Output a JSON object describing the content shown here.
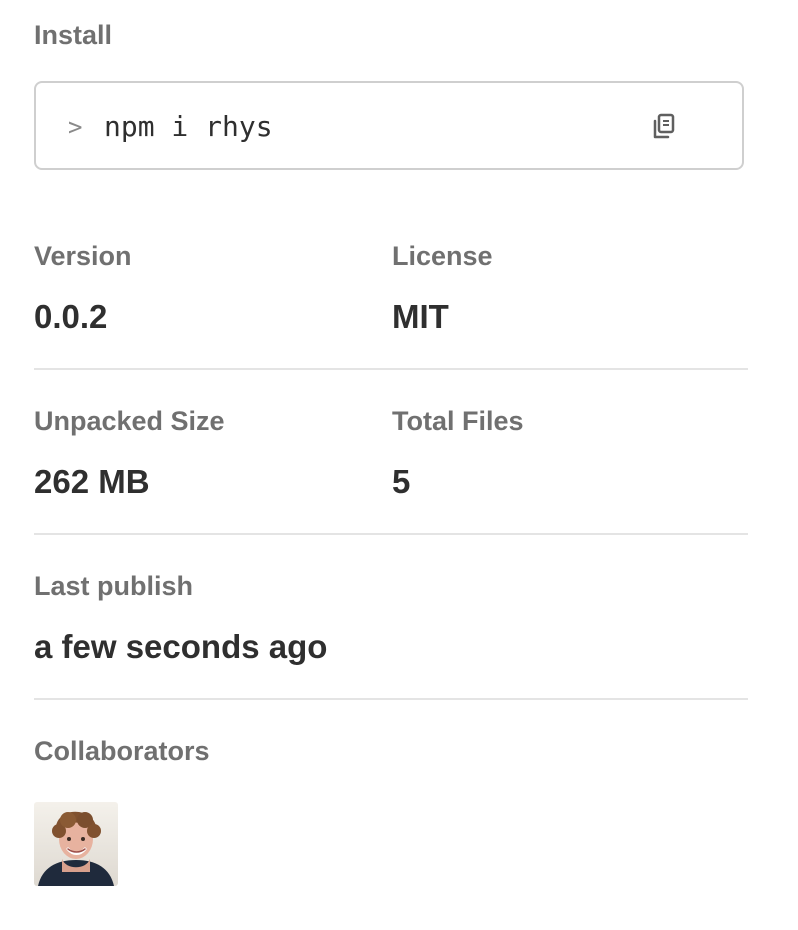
{
  "install": {
    "label": "Install",
    "prompt": ">",
    "command": "npm i rhys",
    "copy_icon": "copy-icon"
  },
  "stats": {
    "version": {
      "label": "Version",
      "value": "0.0.2"
    },
    "license": {
      "label": "License",
      "value": "MIT"
    },
    "unpacked_size": {
      "label": "Unpacked Size",
      "value": "262 MB"
    },
    "total_files": {
      "label": "Total Files",
      "value": "5"
    },
    "last_publish": {
      "label": "Last publish",
      "value": "a few seconds ago"
    }
  },
  "collaborators": {
    "label": "Collaborators",
    "avatar_icon": "collaborator-avatar"
  },
  "colors": {
    "label": "#707070",
    "value": "#2f2f2f",
    "border": "#cfcfcf",
    "divider": "#e4e4e4"
  }
}
